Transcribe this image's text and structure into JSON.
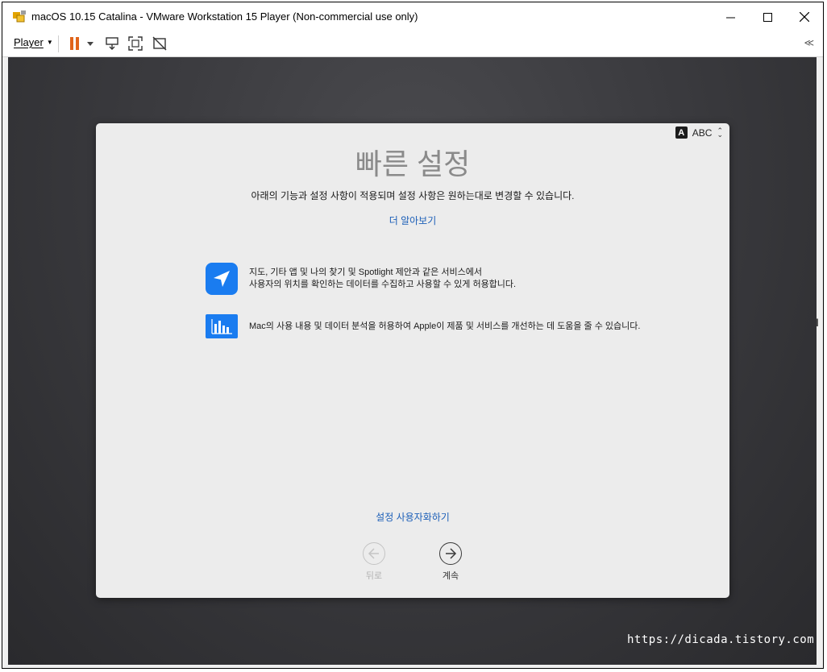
{
  "window": {
    "title": "macOS 10.15 Catalina - VMware Workstation 15 Player (Non-commercial use only)",
    "minimize": "—",
    "maximize": "☐",
    "close": "✕"
  },
  "toolbar": {
    "player_label": "Player",
    "collapse": "≪"
  },
  "input_source": {
    "badge": "A",
    "label": "ABC"
  },
  "setup": {
    "title": "빠른 설정",
    "subtitle": "아래의 기능과 설정 사항이 적용되며 설정 사항은 원하는대로 변경할 수 있습니다.",
    "learn_more": "더 알아보기",
    "features": [
      {
        "icon": "location-arrow-icon",
        "line1": "지도, 기타 앱 및 나의 찾기 및 Spotlight 제안과 같은 서비스에서",
        "line2": "사용자의 위치를 확인하는 데이터를 수집하고 사용할 수 있게 허용합니다."
      },
      {
        "icon": "analytics-bar-chart-icon",
        "line1": "Mac의 사용 내용 및 데이터 분석을 허용하여 Apple이 제품 및 서비스를 개선하는 데 도움을 줄 수 있습니다."
      }
    ],
    "customize": "설정 사용자화하기",
    "back_label": "뒤로",
    "continue_label": "계속"
  },
  "colors": {
    "accent_blue": "#1a7cf0",
    "link_blue": "#1c5fb8",
    "pause_orange": "#e0641b"
  },
  "watermark": "https://dicada.tistory.com"
}
